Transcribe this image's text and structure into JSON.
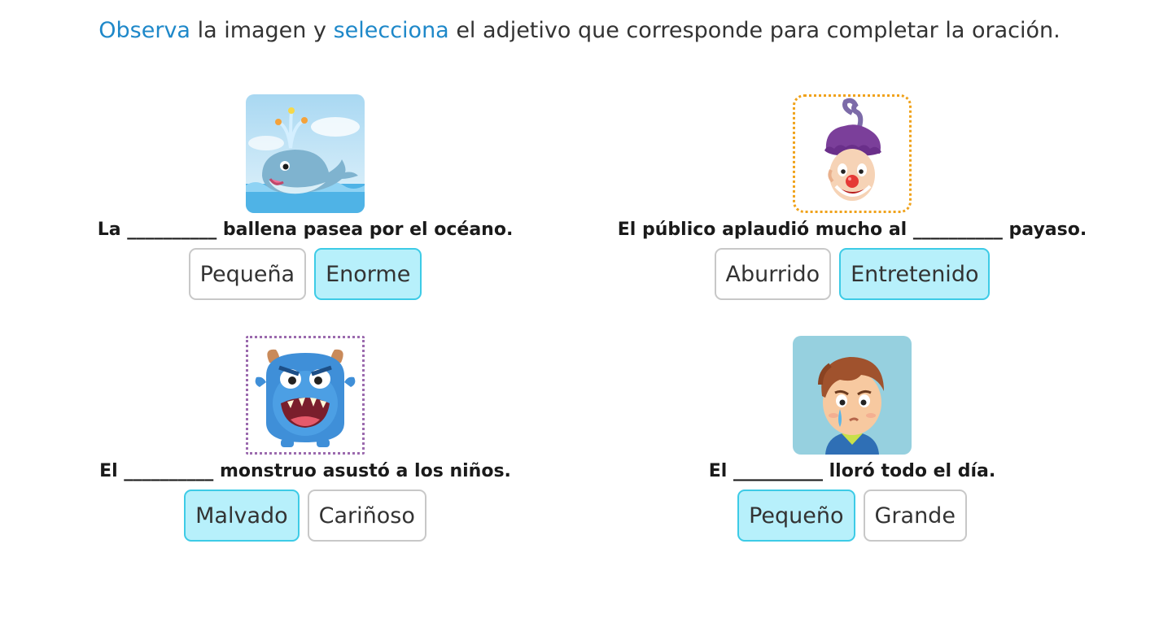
{
  "instruction": {
    "word1": "Observa",
    "mid1": " la imagen y ",
    "word2": "selecciona",
    "rest": " el adjetivo que corresponde para completar la oración."
  },
  "items": [
    {
      "image": "whale-illustration",
      "sentence": "La __________ ballena pasea por el océano.",
      "options": [
        {
          "label": "Pequeña",
          "selected": false
        },
        {
          "label": "Enorme",
          "selected": true
        }
      ]
    },
    {
      "image": "clown-illustration",
      "sentence": "El público aplaudió mucho al __________ payaso.",
      "options": [
        {
          "label": "Aburrido",
          "selected": false
        },
        {
          "label": "Entretenido",
          "selected": true
        }
      ]
    },
    {
      "image": "monster-illustration",
      "sentence": "El __________ monstruo asustó a los niños.",
      "options": [
        {
          "label": "Malvado",
          "selected": true
        },
        {
          "label": "Cariñoso",
          "selected": false
        }
      ]
    },
    {
      "image": "crying-boy-illustration",
      "sentence": "El __________ lloró todo el día.",
      "options": [
        {
          "label": "Pequeño",
          "selected": true
        },
        {
          "label": "Grande",
          "selected": false
        }
      ]
    }
  ],
  "colors": {
    "accent_text": "#1e88c9",
    "selected_bg": "#b7f0fb",
    "selected_border": "#3dcbe6",
    "option_border": "#c8c8c8"
  }
}
